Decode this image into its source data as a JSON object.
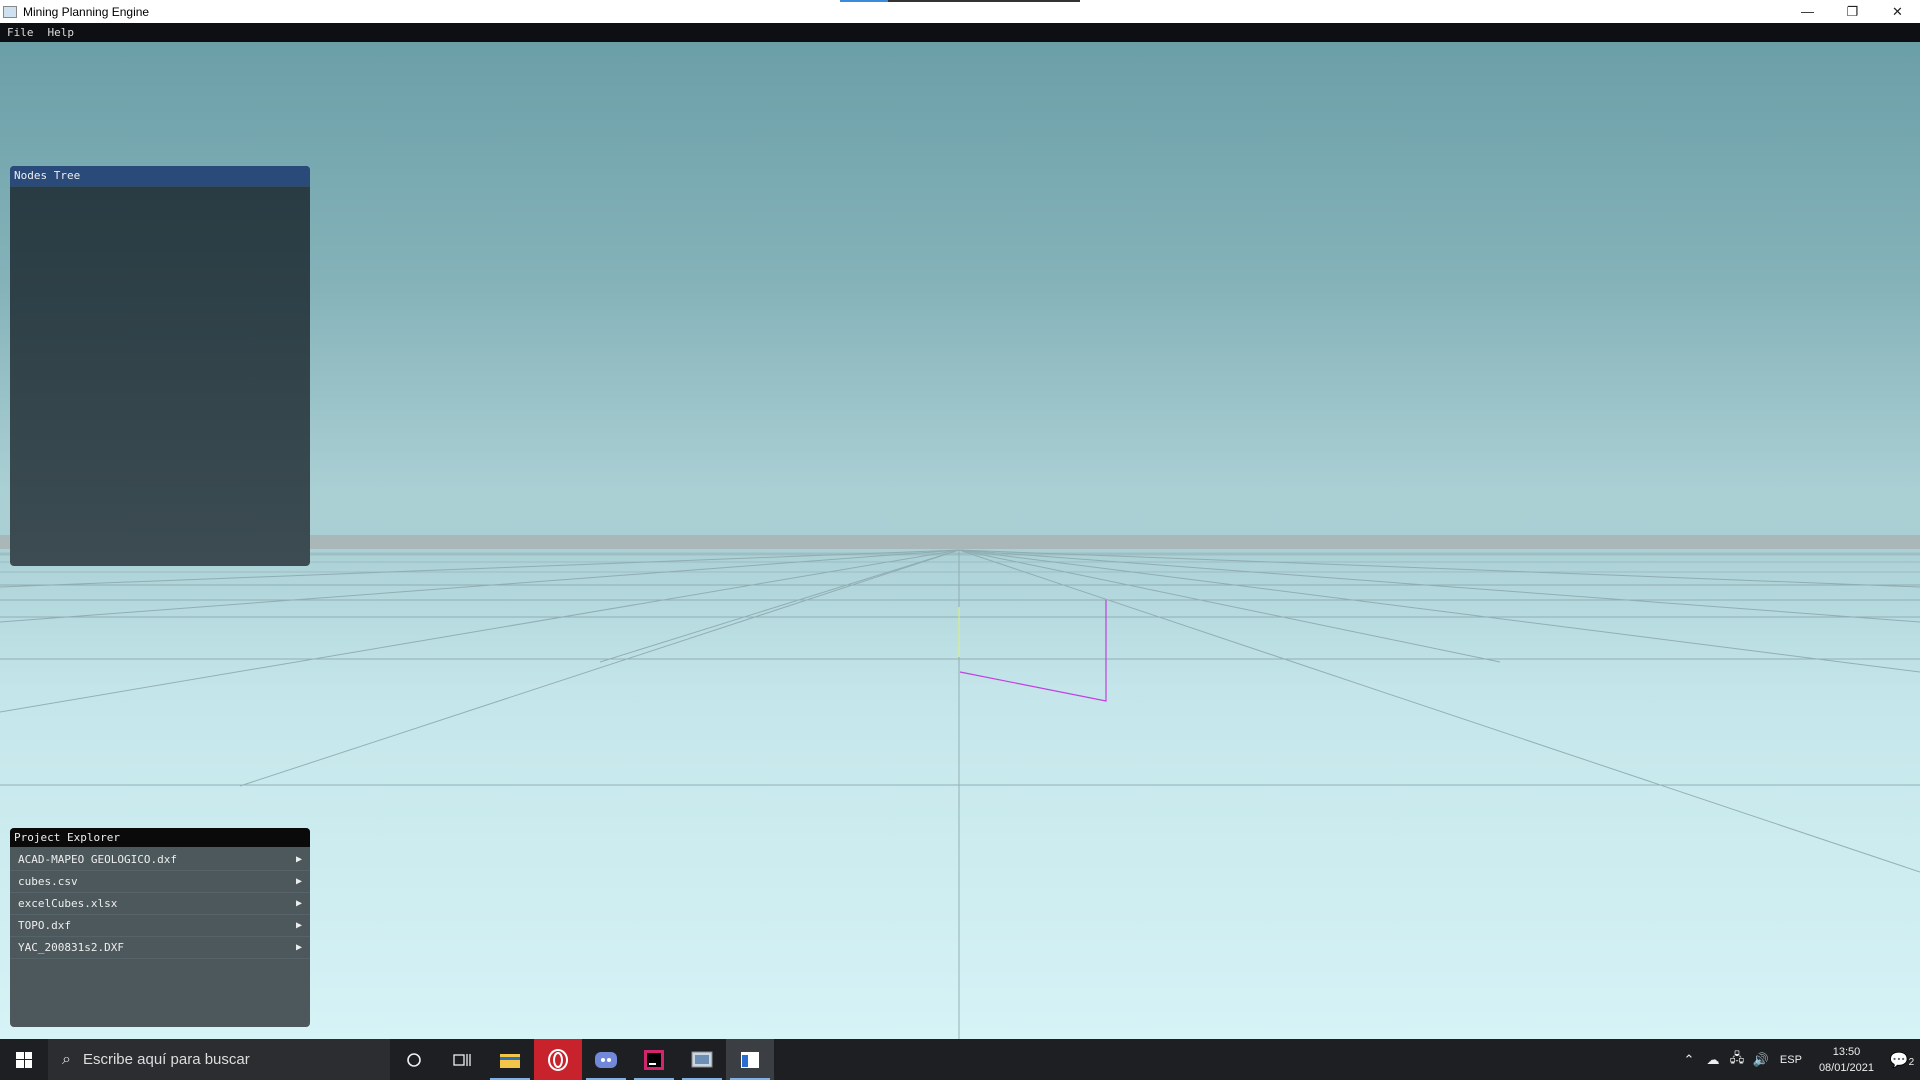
{
  "window": {
    "title": "Mining Planning Engine",
    "minimize": "—",
    "maximize": "❐",
    "close": "✕"
  },
  "menubar": {
    "items": [
      "File",
      "Help"
    ]
  },
  "nodes_tree": {
    "title": "Nodes Tree"
  },
  "project_explorer": {
    "title": "Project Explorer",
    "items": [
      "ACAD-MAPEO GEOLOGICO.dxf",
      "cubes.csv",
      "excelCubes.xlsx",
      "TOPO.dxf",
      "YAC_200831s2.DXF"
    ]
  },
  "taskbar": {
    "search_placeholder": "Escribe aquí para buscar",
    "apps": [
      "cortana-icon",
      "task-view-icon",
      "file-explorer-icon",
      "opera-icon",
      "discord-icon",
      "intellij-icon",
      "app-icon",
      "mining-engine-icon"
    ],
    "language": "ESP",
    "time": "13:50",
    "date": "08/01/2021",
    "notification_count": "2"
  },
  "colors": {
    "sky_top": "#6b9fa8",
    "ground": "#d6f3f6",
    "axis_line": "#c040e0",
    "accent": "#2a4a7a"
  }
}
